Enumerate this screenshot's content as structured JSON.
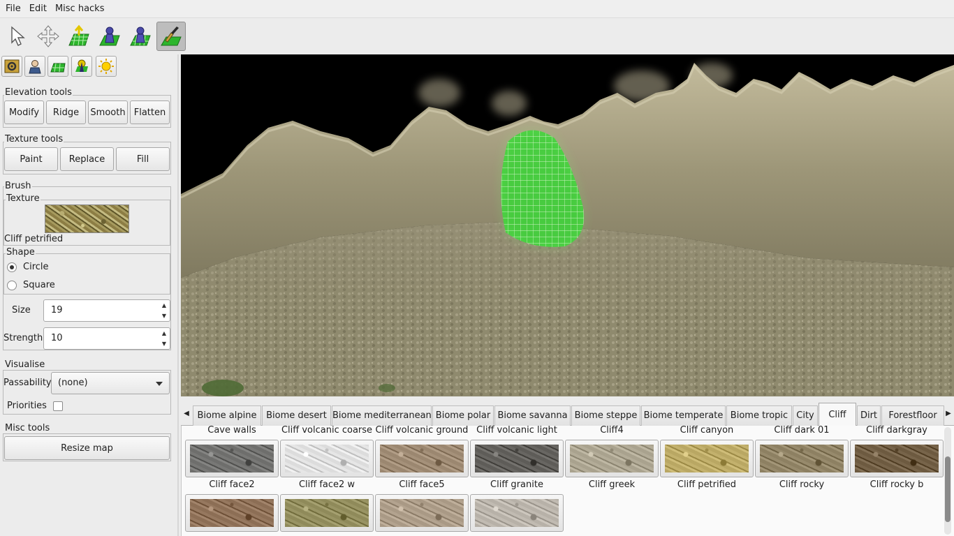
{
  "menubar": {
    "file": "File",
    "edit": "Edit",
    "misc_hacks": "Misc hacks"
  },
  "toolbar": {
    "tools": [
      "select-arrow-icon",
      "move-icon",
      "elevation-icon",
      "place-entity-icon",
      "place-actor-icon",
      "texture-brush-icon"
    ],
    "active_tool": "texture-brush-icon"
  },
  "sidebar": {
    "section_buttons": [
      "settings-icon",
      "player-icon",
      "terrain-icon",
      "object-icon",
      "environment-sun-icon"
    ],
    "elevation": {
      "title": "Elevation tools",
      "modify": "Modify",
      "ridge": "Ridge",
      "smooth": "Smooth",
      "flatten": "Flatten"
    },
    "texture": {
      "title": "Texture tools",
      "paint": "Paint",
      "replace": "Replace",
      "fill": "Fill"
    },
    "brush": {
      "title": "Brush",
      "texture_title": "Texture",
      "texture_name": "Cliff petrified",
      "shape_title": "Shape",
      "circle": "Circle",
      "square": "Square",
      "selected_shape": "Circle",
      "size_label": "Size",
      "size_value": "19",
      "strength_label": "Strength",
      "strength_value": "10"
    },
    "visualise": {
      "title": "Visualise",
      "passability_label": "Passability",
      "passability_value": "(none)",
      "priorities_label": "Priorities",
      "priorities_checked": false
    },
    "misc": {
      "title": "Misc tools",
      "resize_map": "Resize map"
    }
  },
  "tabs": [
    "Biome alpine",
    "Biome desert",
    "Biome mediterranean",
    "Biome polar",
    "Biome savanna",
    "Biome steppe",
    "Biome temperate",
    "Biome tropic",
    "City",
    "Cliff",
    "Dirt",
    "Forestfloor"
  ],
  "active_tab": "Cliff",
  "textures": {
    "row1_labels": [
      "Cave walls",
      "Cliff volcanic coarse",
      "Cliff volcanic ground",
      "Cliff volcanic light",
      "Cliff4",
      "Cliff canyon",
      "Cliff dark 01",
      "Cliff darkgray"
    ],
    "row2_labels": [
      "Cliff face2",
      "Cliff face2 w",
      "Cliff face5",
      "Cliff granite",
      "Cliff greek",
      "Cliff petrified",
      "Cliff rocky",
      "Cliff rocky b"
    ],
    "row1_colors": [
      "#6e6e6c",
      "#dcdcdc",
      "#9b8770",
      "#5e5c58",
      "#a9a28e",
      "#b9a763",
      "#8d8062",
      "#6d5a40"
    ],
    "row2_colors": [
      "#8c6e55",
      "#8f8a5a",
      "#a99985",
      "#b7b1a8"
    ]
  },
  "colors": {
    "accent_active_tool": "#bdbdbd",
    "terrain_brush_green": "#3fd23a"
  }
}
